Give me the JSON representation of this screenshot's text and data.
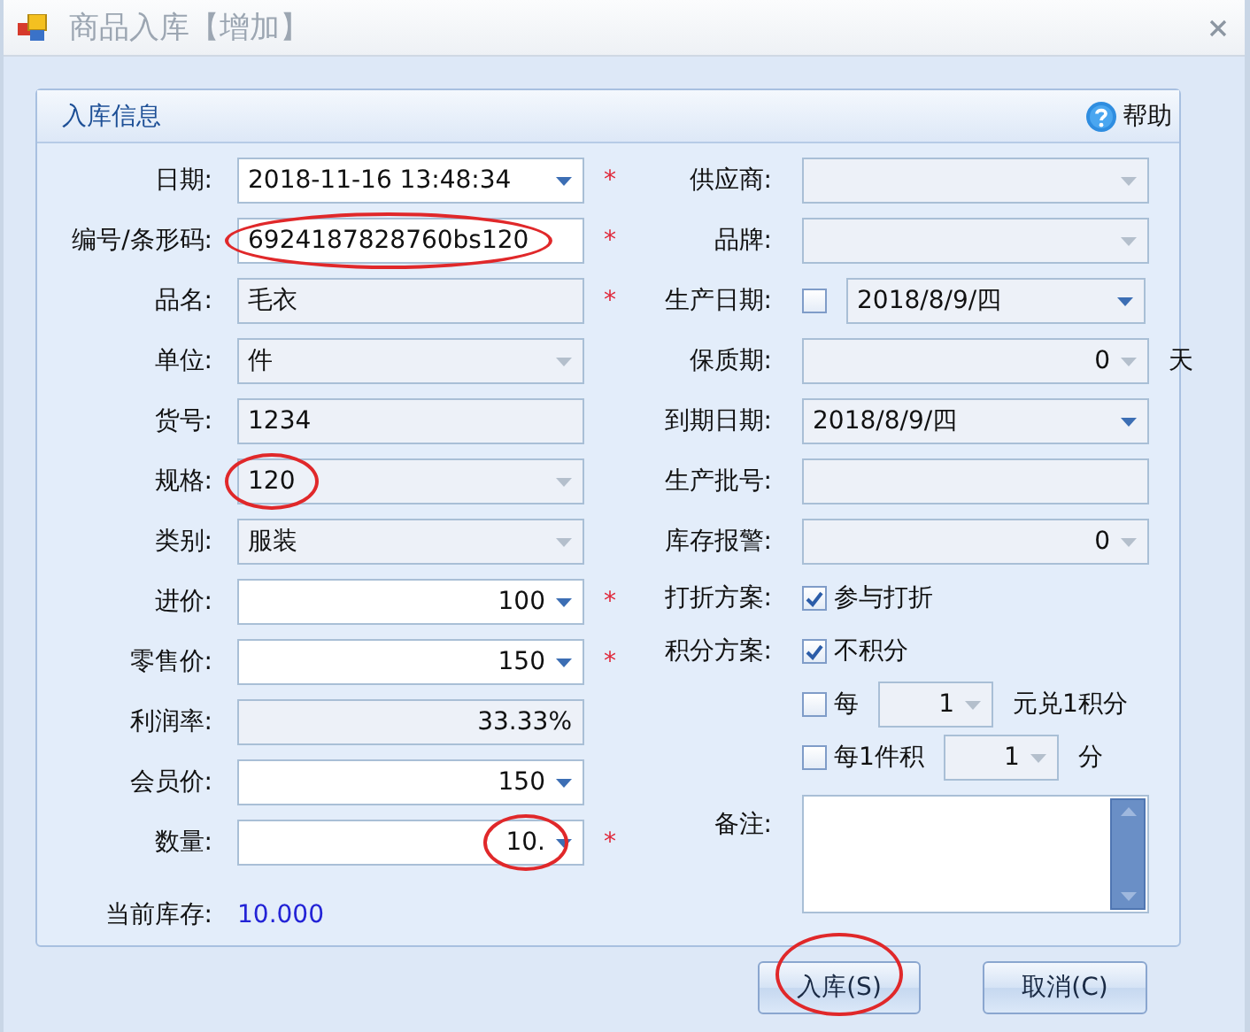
{
  "window": {
    "title": "商品入库【增加】"
  },
  "panel": {
    "title": "入库信息",
    "help": "帮助"
  },
  "left_rows": [
    {
      "label": "日期:",
      "items": [
        {
          "kind": "date",
          "value": "2018-11-16 13:48:34",
          "readonly": false,
          "circled": false
        }
      ],
      "required_mark": "*"
    },
    {
      "label": "编号/条形码:",
      "items": [
        {
          "kind": "text",
          "value": "6924187828760bs120",
          "readonly": false,
          "circled": true
        }
      ],
      "required_mark": "*"
    },
    {
      "label": "品名:",
      "items": [
        {
          "kind": "text",
          "value": "毛衣",
          "readonly": true,
          "circled": false
        }
      ],
      "required_mark": "*"
    },
    {
      "label": "单位:",
      "items": [
        {
          "kind": "combo",
          "value": "件",
          "readonly": true,
          "circled": false
        }
      ]
    },
    {
      "label": "货号:",
      "items": [
        {
          "kind": "text",
          "value": "1234",
          "readonly": true,
          "circled": false
        }
      ]
    },
    {
      "label": "规格:",
      "items": [
        {
          "kind": "combo",
          "value": "120",
          "readonly": true,
          "circled": true
        }
      ]
    },
    {
      "label": "类别:",
      "items": [
        {
          "kind": "combo",
          "value": "服装",
          "readonly": true,
          "circled": false
        }
      ]
    },
    {
      "label": "进价:",
      "items": [
        {
          "kind": "spin",
          "value": "100",
          "readonly": false,
          "circled": false
        }
      ],
      "required_mark": "*"
    },
    {
      "label": "零售价:",
      "items": [
        {
          "kind": "spin",
          "value": "150",
          "readonly": false,
          "circled": false
        }
      ],
      "required_mark": "*"
    },
    {
      "label": "利润率:",
      "items": [
        {
          "kind": "number",
          "value": "33.33%",
          "readonly": true,
          "circled": false
        }
      ]
    },
    {
      "label": "会员价:",
      "items": [
        {
          "kind": "spin",
          "value": "150",
          "readonly": false,
          "circled": false
        }
      ]
    },
    {
      "label": "数量:",
      "items": [
        {
          "kind": "spin",
          "value": "10.",
          "readonly": false,
          "circled": true
        }
      ],
      "required_mark": "*"
    }
  ],
  "stock": {
    "label": "当前库存:",
    "value": "10.000"
  },
  "right_rows": [
    {
      "label": "供应商:",
      "items": [
        {
          "kind": "combo",
          "readonly": true,
          "circled": false
        }
      ]
    },
    {
      "label": "品牌:",
      "items": [
        {
          "kind": "combo",
          "readonly": true,
          "circled": false
        }
      ]
    },
    {
      "label": "生产日期:",
      "items": [
        {
          "kind": "check",
          "checked": false
        },
        {
          "kind": "date",
          "value": "2018/8/9/四",
          "readonly": true,
          "circled": false
        }
      ]
    },
    {
      "label": "保质期:",
      "items": [
        {
          "kind": "spin",
          "value": "0",
          "readonly": true,
          "circled": false
        },
        {
          "kind": "suffix",
          "text": "天"
        }
      ]
    },
    {
      "label": "到期日期:",
      "items": [
        {
          "kind": "date",
          "value": "2018/8/9/四",
          "readonly": true,
          "circled": false
        }
      ]
    },
    {
      "label": "生产批号:",
      "items": [
        {
          "kind": "text",
          "readonly": true,
          "circled": false
        }
      ]
    },
    {
      "label": "库存报警:",
      "items": [
        {
          "kind": "spin",
          "value": "0",
          "readonly": true,
          "circled": false
        }
      ]
    },
    {
      "label": "打折方案:",
      "items": [
        {
          "kind": "check",
          "checked": true,
          "text": "参与打折"
        }
      ]
    },
    {
      "label": "积分方案:",
      "items": [
        {
          "kind": "check",
          "checked": true,
          "text": "不积分"
        }
      ]
    },
    {
      "items": [
        {
          "kind": "check",
          "checked": false,
          "text": "每"
        },
        {
          "kind": "spin",
          "value": "1",
          "readonly": true,
          "circled": false
        },
        {
          "kind": "suffix",
          "text": "元兑1积分"
        }
      ]
    },
    {
      "items": [
        {
          "kind": "check",
          "checked": false,
          "text": "每1件积"
        },
        {
          "kind": "spin",
          "value": "1",
          "readonly": true,
          "circled": false
        },
        {
          "kind": "suffix",
          "text": "分"
        }
      ]
    },
    {
      "label": "备注:",
      "items": [
        {
          "kind": "memo"
        }
      ]
    }
  ],
  "buttons": [
    {
      "label": "入库(S)",
      "circled": true
    },
    {
      "label": "取消(C)",
      "circled": false
    }
  ]
}
